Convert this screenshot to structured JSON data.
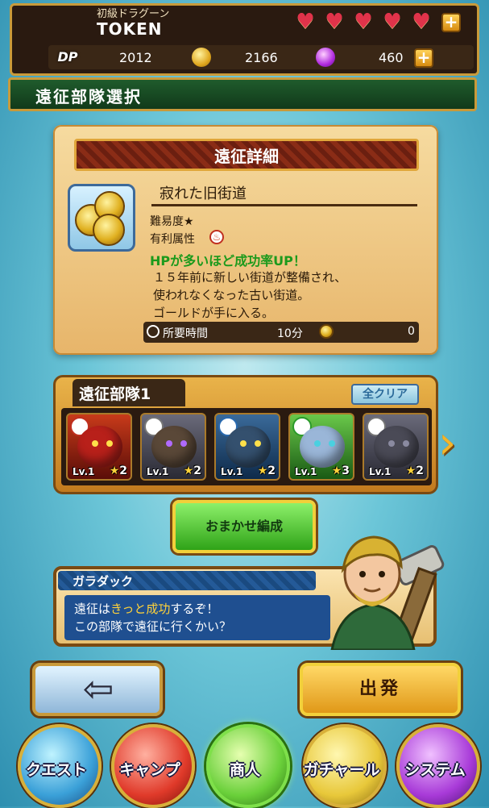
{
  "status": {
    "rank": "初級ドラグーン",
    "player_name": "TOKEN",
    "hearts": 5,
    "dp_icon": "DP",
    "dp": "2012",
    "gold": "2166",
    "gems": "460",
    "plus_label": "+"
  },
  "screen_title": "遠征部隊選択",
  "expedition": {
    "banner": "遠征詳細",
    "quest_name": "寂れた旧街道",
    "difficulty": "難易度★",
    "attribute_label": "有利属性",
    "bonus": "HPが多いほど成功率UP！",
    "description": "１５年前に新しい街道が整備され、\n使われなくなった古い街道。\nゴールドが手に入る。",
    "time_label": "所要時間",
    "time_value": "10分",
    "reward_value": "0"
  },
  "party": {
    "title": "遠征部隊1",
    "clear_label": "全クリア",
    "slots": [
      {
        "level": "Lv.1",
        "stars": "2",
        "attr": "fire"
      },
      {
        "level": "Lv.1",
        "stars": "2",
        "attr": "neutral"
      },
      {
        "level": "Lv.1",
        "stars": "2",
        "attr": "water"
      },
      {
        "level": "Lv.1",
        "stars": "3",
        "attr": "wind"
      },
      {
        "level": "Lv.1",
        "stars": "2",
        "attr": "neutral"
      }
    ]
  },
  "auto_label": "おまかせ編成",
  "dialog": {
    "speaker": "ガラダック",
    "line1_pre": "遠征は",
    "line1_highlight": "きっと成功",
    "line1_post": "するぞ！",
    "line2": "この部隊で遠征に行くかい？"
  },
  "depart_label": "出発",
  "nav": {
    "quest": "クエスト",
    "camp": "キャンプ",
    "shop": "商人",
    "gacha": "ガチャール",
    "system": "システム"
  },
  "colors": {
    "gold": "#c99a3a",
    "header_green": "#1f5b2c",
    "bonus_green": "#1c9a1c",
    "dialog_blue": "#1f4f90"
  }
}
